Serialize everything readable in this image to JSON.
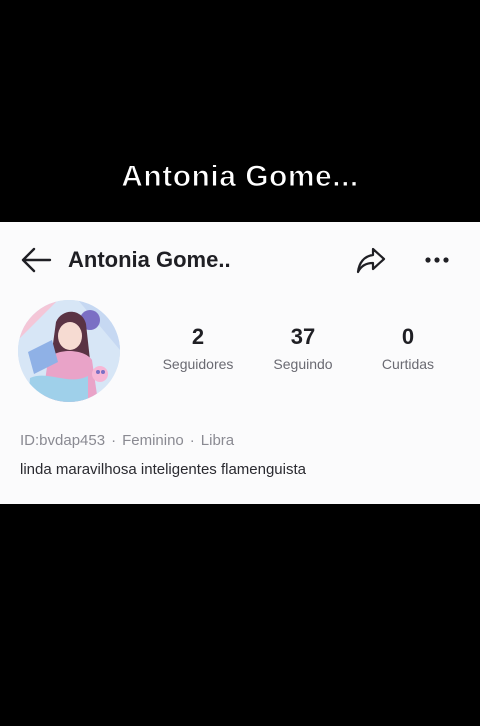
{
  "overlay": {
    "caption": "Antonia Gome..."
  },
  "header": {
    "title": "Antonia Gome.."
  },
  "stats": {
    "followers": {
      "value": "2",
      "label": "Seguidores"
    },
    "following": {
      "value": "37",
      "label": "Seguindo"
    },
    "likes": {
      "value": "0",
      "label": "Curtidas"
    }
  },
  "profile": {
    "id": "ID:bvdap453",
    "gender": "Feminino",
    "sign": "Libra",
    "separator": "·",
    "bio": "linda maravilhosa inteligentes flamenguista"
  },
  "icons": {
    "back": "arrow-left-icon",
    "share": "share-icon",
    "more": "more-dots-icon"
  }
}
